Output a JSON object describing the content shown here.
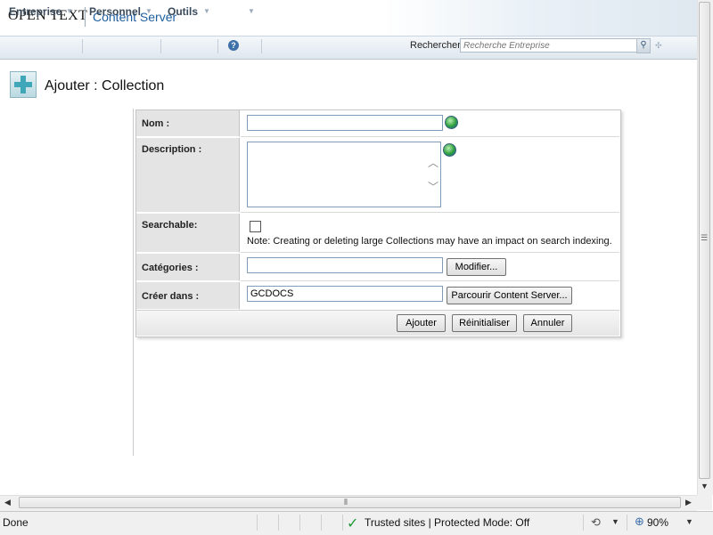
{
  "header": {
    "brand": "OPEN TEXT",
    "product": "Content Server"
  },
  "nav": {
    "items": [
      {
        "label": "Entreprise"
      },
      {
        "label": "Personnel"
      },
      {
        "label": "Outils"
      }
    ],
    "help_icon": "?",
    "search_label": "Rechercher",
    "search_placeholder": "Recherche Entreprise"
  },
  "page": {
    "title": "Ajouter : Collection"
  },
  "form": {
    "name_label": "Nom :",
    "name_value": "",
    "description_label": "Description :",
    "description_value": "",
    "searchable_label": "Searchable:",
    "searchable_checked": false,
    "searchable_note": "Note: Creating or deleting large Collections may have an impact on search indexing.",
    "categories_label": "Catégories :",
    "categories_value": "",
    "modify_button": "Modifier...",
    "create_in_label": "Créer dans :",
    "create_in_value": "GCDOCS",
    "browse_button": "Parcourir Content Server...",
    "add_button": "Ajouter",
    "reset_button": "Réinitialiser",
    "cancel_button": "Annuler"
  },
  "statusbar": {
    "status": "Done",
    "zone": "Trusted sites | Protected Mode: Off",
    "zoom": "90%"
  },
  "colors": {
    "accent": "#1f5fa0",
    "nav_text": "#3a4a5a",
    "label_bg": "#e4e4e4",
    "trusted_check": "#1f9a35"
  }
}
